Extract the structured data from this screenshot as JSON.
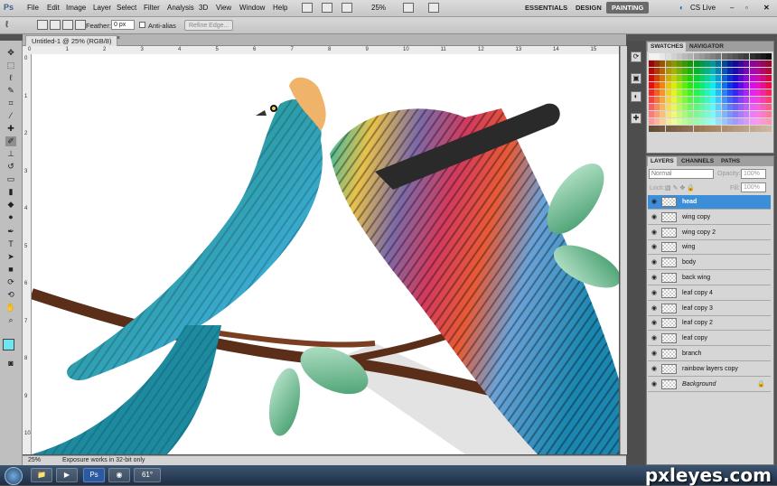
{
  "app": {
    "logo": "Ps"
  },
  "menu": [
    "File",
    "Edit",
    "Image",
    "Layer",
    "Select",
    "Filter",
    "Analysis",
    "3D",
    "View",
    "Window",
    "Help"
  ],
  "toolbar_right": {
    "zoom": "25%"
  },
  "workspaces": [
    {
      "label": "ESSENTIALS",
      "active": false
    },
    {
      "label": "DESIGN",
      "active": false
    },
    {
      "label": "PAINTING",
      "active": true
    }
  ],
  "cslive": "CS Live",
  "options": {
    "feather_label": "Feather:",
    "feather_value": "0 px",
    "antialias_label": "Anti-alias",
    "refine_label": "Refine Edge..."
  },
  "document": {
    "tab_title": "Untitled-1 @ 25% (RGB/8)",
    "ruler_top": [
      "0",
      "1",
      "2",
      "3",
      "4",
      "5",
      "6",
      "7",
      "8",
      "9",
      "10",
      "11",
      "12",
      "13",
      "14",
      "15"
    ],
    "ruler_left": [
      "0",
      "1",
      "2",
      "3",
      "4",
      "5",
      "6",
      "7",
      "8",
      "9",
      "10"
    ],
    "status_zoom": "25%",
    "status_text": "Exposure works in 32-bit only"
  },
  "swatches_panel": {
    "tabs": [
      "SWATCHES",
      "NAVIGATOR"
    ]
  },
  "layers_panel": {
    "tabs": [
      "LAYERS",
      "CHANNELS",
      "PATHS"
    ],
    "blend_mode": "Normal",
    "opacity_label": "Opacity:",
    "opacity_value": "100%",
    "lock_label": "Lock:",
    "fill_label": "Fill:",
    "fill_value": "100%",
    "layers": [
      {
        "name": "head",
        "selected": true
      },
      {
        "name": "wing copy",
        "selected": false
      },
      {
        "name": "wing copy 2",
        "selected": false
      },
      {
        "name": "wing",
        "selected": false
      },
      {
        "name": "body",
        "selected": false
      },
      {
        "name": "back wing",
        "selected": false
      },
      {
        "name": "leaf copy 4",
        "selected": false
      },
      {
        "name": "leaf copy 3",
        "selected": false
      },
      {
        "name": "leaf copy 2",
        "selected": false
      },
      {
        "name": "leaf copy",
        "selected": false
      },
      {
        "name": "branch",
        "selected": false
      },
      {
        "name": "rainbow layers copy",
        "selected": false
      },
      {
        "name": "Background",
        "selected": false
      }
    ]
  },
  "taskbar": {
    "clock": "61°"
  },
  "watermark": "pxleyes.com",
  "colors": {
    "accent": "#3d8ed8",
    "foreground": "#6ee6f0",
    "background": "#ffffff"
  }
}
